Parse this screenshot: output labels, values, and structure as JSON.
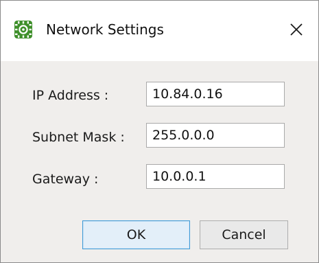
{
  "window": {
    "title": "Network Settings",
    "icon": "gear-chip-icon",
    "close_glyph": "✕"
  },
  "fields": {
    "ip": {
      "label": "IP Address :",
      "value": "10.84.0.16"
    },
    "subnet": {
      "label": "Subnet Mask :",
      "value": "255.0.0.0"
    },
    "gateway": {
      "label": "Gateway :",
      "value": "10.0.0.1"
    }
  },
  "buttons": {
    "ok_label": "OK",
    "cancel_label": "Cancel"
  },
  "colors": {
    "icon_green": "#3e8f2a",
    "ok_border": "#3e9bd8",
    "dialog_background": "#f0eeec"
  }
}
